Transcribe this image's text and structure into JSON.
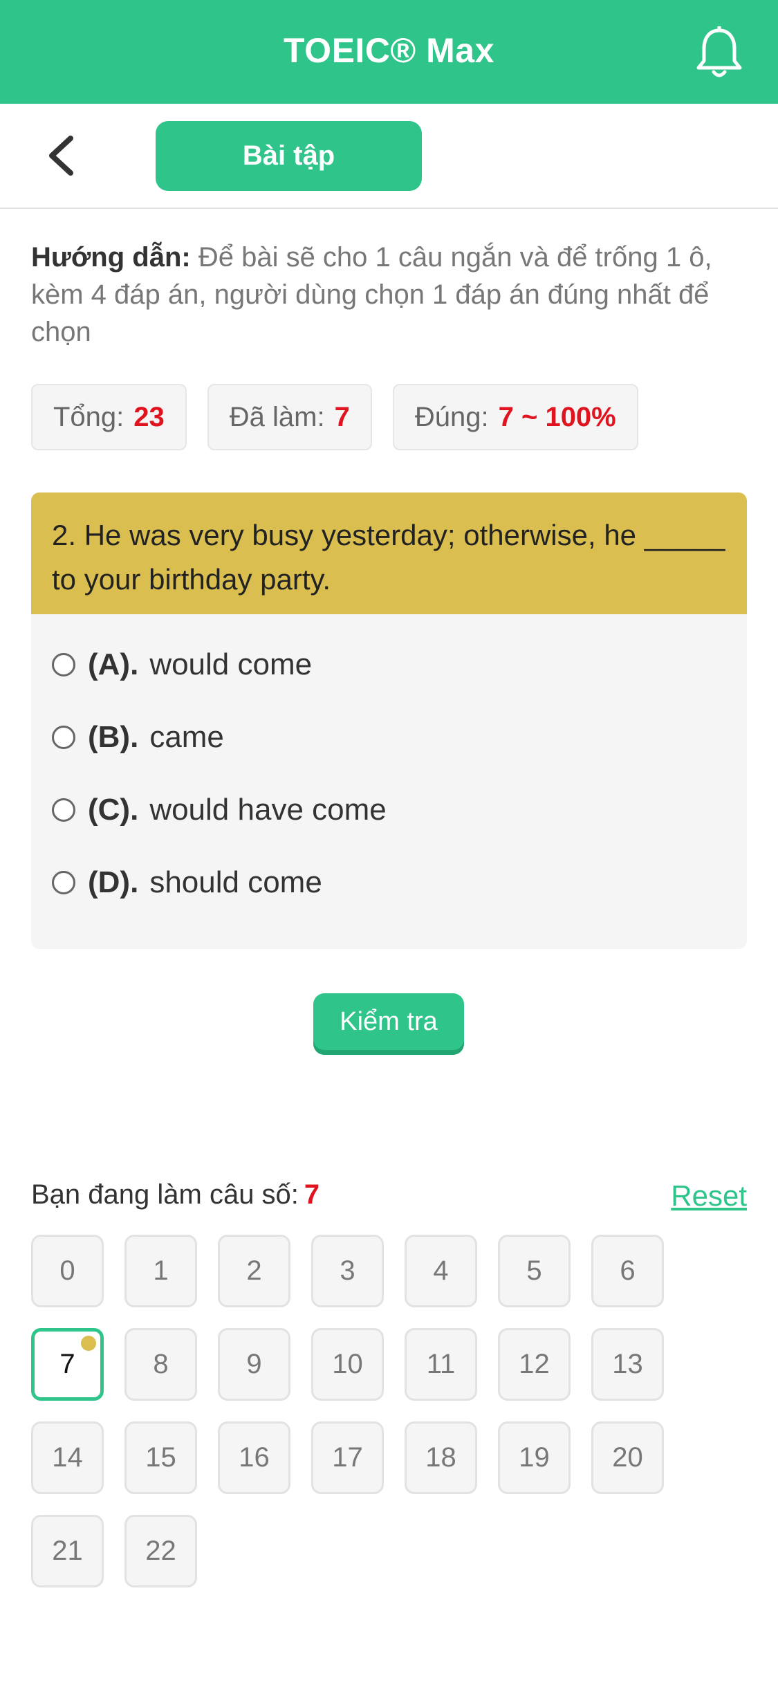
{
  "app": {
    "title": "TOEIC® Max"
  },
  "header": {
    "tab_label": "Bài tập"
  },
  "instructions": {
    "label": "Hướng dẫn:",
    "text": "Để bài sẽ cho 1 câu ngắn và để trống 1 ô, kèm 4 đáp án, người dùng chọn 1 đáp án đúng nhất để chọn"
  },
  "stats": {
    "total_label": "Tổng:",
    "total_value": "23",
    "done_label": "Đã làm:",
    "done_value": "7",
    "correct_label": "Đúng:",
    "correct_value": "7 ~ 100%"
  },
  "question": {
    "text": "2. He was very busy yesterday; otherwise, he _____ to your birthday party.",
    "options": [
      {
        "letter": "(A).",
        "text": "would come"
      },
      {
        "letter": "(B).",
        "text": "came"
      },
      {
        "letter": "(C).",
        "text": "would have come"
      },
      {
        "letter": "(D).",
        "text": "should come"
      }
    ]
  },
  "check_button": "Kiểm tra",
  "progress": {
    "label": "Bạn đang làm câu số:",
    "current": "7",
    "reset_label": "Reset",
    "numbers": [
      "0",
      "1",
      "2",
      "3",
      "4",
      "5",
      "6",
      "7",
      "8",
      "9",
      "10",
      "11",
      "12",
      "13",
      "14",
      "15",
      "16",
      "17",
      "18",
      "19",
      "20",
      "21",
      "22"
    ]
  },
  "colors": {
    "primary": "#2ec48a",
    "question_header": "#dabf50",
    "accent_red": "#e0141e"
  }
}
